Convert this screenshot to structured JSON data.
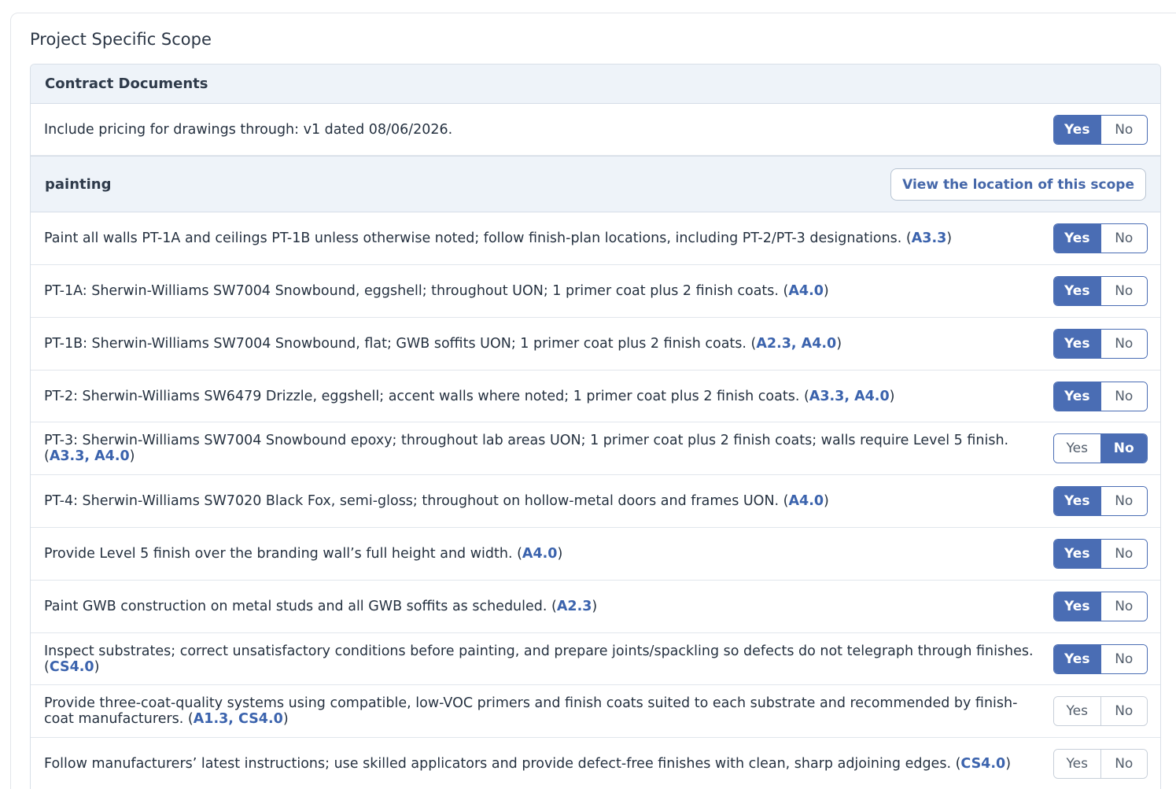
{
  "page_title": "Project Specific Scope",
  "sections": [
    {
      "title": "Contract Documents",
      "rows": [
        {
          "text": "Include pricing for drawings through: v1 dated 08/06/2026.",
          "refs": [],
          "selected": "yes"
        }
      ]
    },
    {
      "title": "painting",
      "action_label": "View the location of this scope",
      "rows": [
        {
          "text": "Paint all walls PT-1A and ceilings PT-1B unless otherwise noted; follow finish-plan locations, including PT-2/PT-3 designations.",
          "refs": [
            "A3.3"
          ],
          "selected": "yes"
        },
        {
          "text": "PT-1A: Sherwin-Williams SW7004 Snowbound, eggshell; throughout UON; 1 primer coat plus 2 finish coats.",
          "refs": [
            "A4.0"
          ],
          "selected": "yes"
        },
        {
          "text": "PT-1B: Sherwin-Williams SW7004 Snowbound, flat; GWB soffits UON; 1 primer coat plus 2 finish coats.",
          "refs": [
            "A2.3",
            "A4.0"
          ],
          "selected": "yes"
        },
        {
          "text": "PT-2: Sherwin-Williams SW6479 Drizzle, eggshell; accent walls where noted; 1 primer coat plus 2 finish coats.",
          "refs": [
            "A3.3",
            "A4.0"
          ],
          "selected": "yes"
        },
        {
          "text": "PT-3: Sherwin-Williams SW7004 Snowbound epoxy; throughout lab areas UON; 1 primer coat plus 2 finish coats; walls require Level 5 finish.",
          "refs": [
            "A3.3",
            "A4.0"
          ],
          "selected": "no"
        },
        {
          "text": "PT-4: Sherwin-Williams SW7020 Black Fox, semi-gloss; throughout on hollow-metal doors and frames UON.",
          "refs": [
            "A4.0"
          ],
          "selected": "yes"
        },
        {
          "text": "Provide Level 5 finish over the branding wall’s full height and width.",
          "refs": [
            "A4.0"
          ],
          "selected": "yes"
        },
        {
          "text": "Paint GWB construction on metal studs and all GWB soffits as scheduled.",
          "refs": [
            "A2.3"
          ],
          "selected": "yes"
        },
        {
          "text": "Inspect substrates; correct unsatisfactory conditions before painting, and prepare joints/spackling so defects do not telegraph through finishes.",
          "refs": [
            "CS4.0"
          ],
          "selected": "yes"
        },
        {
          "text": "Provide three-coat-quality systems using compatible, low-VOC primers and finish coats suited to each substrate and recommended by finish-coat manufacturers.",
          "refs": [
            "A1.3",
            "CS4.0"
          ],
          "selected": "none"
        },
        {
          "text": "Follow manufacturers’ latest instructions; use skilled applicators and provide defect-free finishes with clean, sharp adjoining edges.",
          "refs": [
            "CS4.0"
          ],
          "selected": "none"
        }
      ]
    }
  ],
  "toggle": {
    "yes_label": "Yes",
    "no_label": "No"
  },
  "colors": {
    "accent": "#4a6db4",
    "ref": "#3b63ad",
    "header_bg": "#eef3f9"
  }
}
